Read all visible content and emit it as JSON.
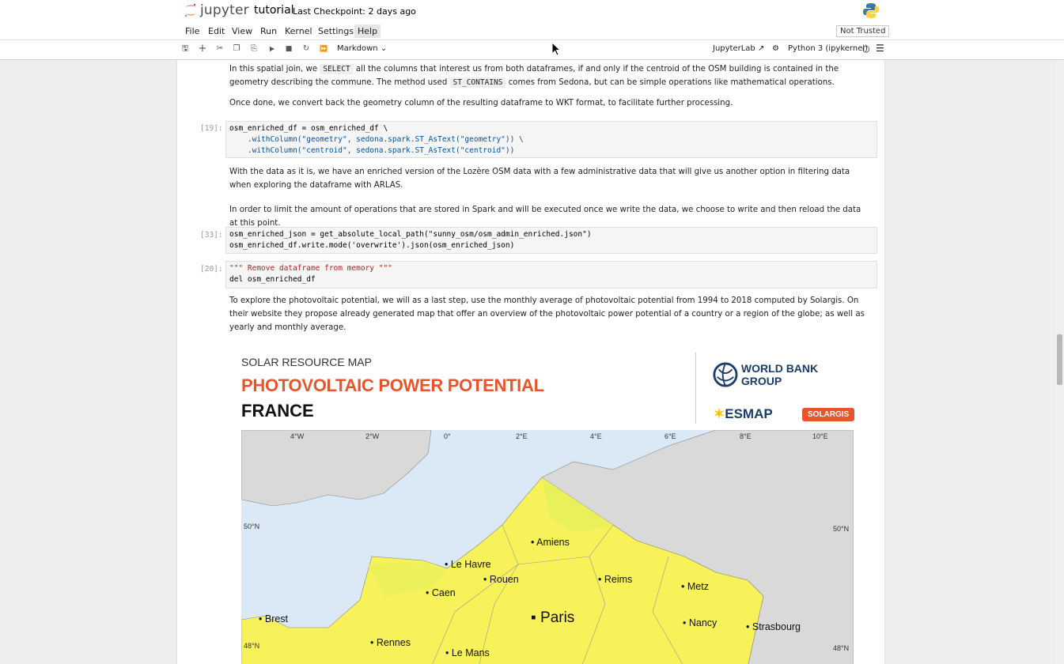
{
  "app": {
    "logo_text": "jupyter",
    "notebook_name": "tutorial",
    "checkpoint": "Last Checkpoint: 2 days ago",
    "trust_status": "Not Trusted"
  },
  "menu": [
    "File",
    "Edit",
    "View",
    "Run",
    "Kernel",
    "Settings",
    "Help"
  ],
  "toolbar": {
    "cell_type": "Markdown",
    "jupyterlab_label": "JupyterLab",
    "kernel_name": "Python 3 (ipykernel)",
    "icons": [
      "save-icon",
      "add-icon",
      "cut-icon",
      "copy-icon",
      "paste-icon",
      "run-icon",
      "stop-icon",
      "restart-icon",
      "fast-forward-icon"
    ]
  },
  "cells": {
    "md1_pre1": "In this spatial join, we ",
    "md1_code1": "SELECT",
    "md1_mid1": " all the columns that interest us from both dataframes, if and only if the centroid of the OSM building is contained in the geometry describing the commune. The method used ",
    "md1_code2": "ST_CONTAINS",
    "md1_post": " comes from Sedona, but can be simple operations like mathematical operations.",
    "md2": "Once done, we convert back the geometry column of the resulting dataframe to WKT format, to facilitate further processing.",
    "prompt19": "[19]:",
    "code19_l1": "osm_enriched_df = osm_enriched_df \\",
    "code19_l2": "    .withColumn(\"geometry\", sedona.spark.ST_AsText(\"geometry\")) \\",
    "code19_l3": "    .withColumn(\"centroid\", sedona.spark.ST_AsText(\"centroid\"))",
    "md3": "With the data as it is, we have an enriched version of the Lozère OSM data with a few administrative data that will give us another option in filtering data when exploring the dataframe with ARLAS.",
    "md4": "In order to limit the amount of operations that are stored in Spark and will be executed once we write the data, we choose to write and then reload the data at this point.",
    "prompt33": "[33]:",
    "code33_l1": "osm_enriched_json = get_absolute_local_path(\"sunny_osm/osm_admin_enriched.json\")",
    "code33_l2": "osm_enriched_df.write.mode('overwrite').json(osm_enriched_json)",
    "prompt20": "[20]:",
    "code20_l1": "\"\"\" Remove dataframe from memory \"\"\"",
    "code20_l2": "del osm_enriched_df",
    "md5": "To explore the photovoltaic potential, we will as a last step, use the monthly average of photovoltaic potential from 1994 to 2018 computed by Solargis. On their website they propose already generated map that offer an overview of the photovoltaic power potential of a country or a region of the globe; as well as yearly and monthly average."
  },
  "solar_map": {
    "header": "SOLAR RESOURCE MAP",
    "title": "PHOTOVOLTAIC POWER POTENTIAL",
    "country": "FRANCE",
    "wbg": "WORLD BANK GROUP",
    "esmap": "ESMAP",
    "solargis": "SOLARGIS",
    "longitudes": [
      "4°W",
      "2°W",
      "0°",
      "2°E",
      "4°E",
      "6°E",
      "8°E",
      "10°E"
    ],
    "lat_50": "50°N",
    "lat_48": "48°N",
    "cities": [
      "Amiens",
      "Le Havre",
      "Rouen",
      "Caen",
      "Reims",
      "Metz",
      "Paris",
      "Brest",
      "Nancy",
      "Strasbourg",
      "Rennes",
      "Le Mans"
    ]
  },
  "colors": {
    "accent": "#e8552a",
    "sea": "#dbe9f7",
    "land_other": "#d9d9d9",
    "pv_low": "#e8f05a",
    "pv_high": "#f7f25a"
  }
}
